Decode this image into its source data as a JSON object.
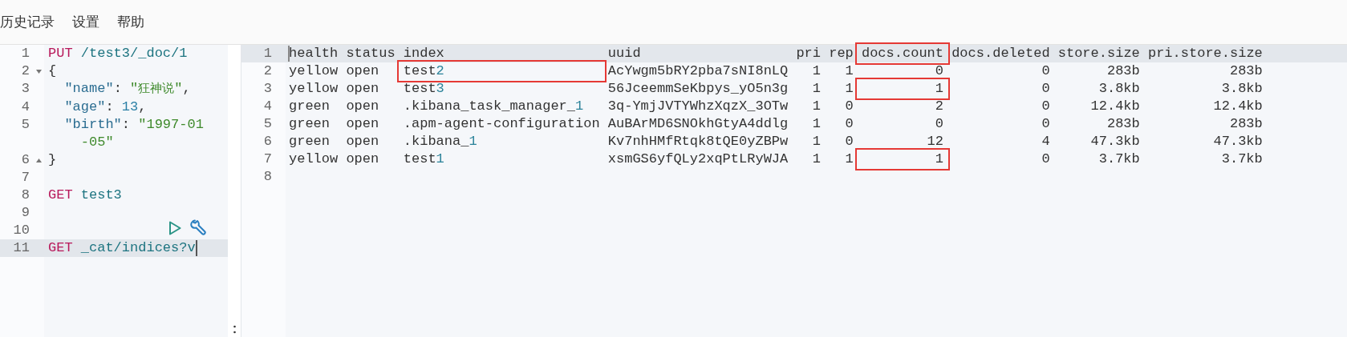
{
  "menu": [
    {
      "label": "历史记录"
    },
    {
      "label": "设置"
    },
    {
      "label": "帮助"
    }
  ],
  "editor": {
    "lines": [
      {
        "number": "1",
        "fold_start": false,
        "fold_end": false,
        "active": false,
        "actions": false,
        "tokens": [
          {
            "kind": "method",
            "text": "PUT"
          },
          {
            "kind": "path",
            "text": " /test3/_doc/1"
          }
        ]
      },
      {
        "number": "2",
        "fold_start": true,
        "fold_end": false,
        "active": false,
        "actions": false,
        "tokens": [
          {
            "kind": "punct",
            "text": "{"
          }
        ]
      },
      {
        "number": "3",
        "fold_start": false,
        "fold_end": false,
        "active": false,
        "actions": false,
        "tokens": [
          {
            "kind": "key",
            "text": "  \"name\""
          },
          {
            "kind": "punct",
            "text": ": "
          },
          {
            "kind": "string",
            "text": "\"狂神说\""
          },
          {
            "kind": "punct",
            "text": ","
          }
        ]
      },
      {
        "number": "4",
        "fold_start": false,
        "fold_end": false,
        "active": false,
        "actions": false,
        "tokens": [
          {
            "kind": "key",
            "text": "  \"age\""
          },
          {
            "kind": "punct",
            "text": ": "
          },
          {
            "kind": "number",
            "text": "13"
          },
          {
            "kind": "punct",
            "text": ","
          }
        ]
      },
      {
        "number": "5",
        "fold_start": false,
        "fold_end": false,
        "active": false,
        "actions": false,
        "tokens": [
          {
            "kind": "key",
            "text": "  \"birth\""
          },
          {
            "kind": "punct",
            "text": ": "
          },
          {
            "kind": "string",
            "text": "\"1997-01-05\""
          }
        ]
      },
      {
        "number": "6",
        "fold_start": false,
        "fold_end": true,
        "active": false,
        "actions": false,
        "tokens": [
          {
            "kind": "punct",
            "text": "}"
          }
        ]
      },
      {
        "number": "7",
        "fold_start": false,
        "fold_end": false,
        "active": false,
        "actions": false
      },
      {
        "number": "8",
        "fold_start": false,
        "fold_end": false,
        "active": false,
        "actions": false,
        "tokens": [
          {
            "kind": "method",
            "text": "GET"
          },
          {
            "kind": "path",
            "text": " test3"
          }
        ]
      },
      {
        "number": "9",
        "fold_start": false,
        "fold_end": false,
        "active": false,
        "actions": false
      },
      {
        "number": "10",
        "fold_start": false,
        "fold_end": false,
        "active": false,
        "actions": true
      },
      {
        "number": "11",
        "fold_start": false,
        "fold_end": false,
        "active": true,
        "actions": false,
        "tokens": [
          {
            "kind": "method",
            "text": "GET"
          },
          {
            "kind": "path",
            "text": " _cat/indices?v"
          }
        ]
      }
    ]
  },
  "output": {
    "columns": [
      {
        "right_aligned": false
      },
      {
        "right_aligned": false
      },
      {
        "right_aligned": false
      },
      {
        "right_aligned": false
      },
      {
        "right_aligned": true
      },
      {
        "right_aligned": true
      },
      {
        "right_aligned": true
      },
      {
        "right_aligned": true
      },
      {
        "right_aligned": true
      },
      {
        "right_aligned": true
      }
    ],
    "lines": [
      {
        "number": "1",
        "active": true,
        "kind": "header",
        "cells": [
          {
            "text": "health",
            "highlighted": false
          },
          {
            "text": "status",
            "highlighted": false
          },
          {
            "text": "index",
            "highlighted": false
          },
          {
            "text": "uuid",
            "highlighted": false
          },
          {
            "text": "pri",
            "highlighted": false
          },
          {
            "text": "rep",
            "highlighted": false
          },
          {
            "text": "docs.count",
            "highlighted": true
          },
          {
            "text": "docs.deleted",
            "highlighted": false
          },
          {
            "text": "store.size",
            "highlighted": false
          },
          {
            "text": "pri.store.size",
            "highlighted": false
          }
        ]
      },
      {
        "number": "2",
        "active": false,
        "kind": "row",
        "cells": [
          {
            "text": "yellow",
            "highlighted": false
          },
          {
            "text": "open",
            "highlighted": false
          },
          {
            "text": "test2",
            "highlighted": true
          },
          {
            "text": "AcYwgm5bRY2pba7sNI8nLQ",
            "highlighted": false
          },
          {
            "text": "1",
            "highlighted": false
          },
          {
            "text": "1",
            "highlighted": false
          },
          {
            "text": "0",
            "highlighted": false
          },
          {
            "text": "0",
            "highlighted": false
          },
          {
            "text": "283b",
            "highlighted": false
          },
          {
            "text": "283b",
            "highlighted": false
          }
        ]
      },
      {
        "number": "3",
        "active": false,
        "kind": "row",
        "cells": [
          {
            "text": "yellow",
            "highlighted": false
          },
          {
            "text": "open",
            "highlighted": false
          },
          {
            "text": "test3",
            "highlighted": false
          },
          {
            "text": "56JceemmSeKbpys_yO5n3g",
            "highlighted": false
          },
          {
            "text": "1",
            "highlighted": false
          },
          {
            "text": "1",
            "highlighted": false
          },
          {
            "text": "1",
            "highlighted": true
          },
          {
            "text": "0",
            "highlighted": false
          },
          {
            "text": "3.8kb",
            "highlighted": false
          },
          {
            "text": "3.8kb",
            "highlighted": false
          }
        ]
      },
      {
        "number": "4",
        "active": false,
        "kind": "row",
        "cells": [
          {
            "text": "green",
            "highlighted": false
          },
          {
            "text": "open",
            "highlighted": false
          },
          {
            "text": ".kibana_task_manager_1",
            "highlighted": false
          },
          {
            "text": "3q-YmjJVTYWhzXqzX_3OTw",
            "highlighted": false
          },
          {
            "text": "1",
            "highlighted": false
          },
          {
            "text": "0",
            "highlighted": false
          },
          {
            "text": "2",
            "highlighted": false
          },
          {
            "text": "0",
            "highlighted": false
          },
          {
            "text": "12.4kb",
            "highlighted": false
          },
          {
            "text": "12.4kb",
            "highlighted": false
          }
        ]
      },
      {
        "number": "5",
        "active": false,
        "kind": "row",
        "cells": [
          {
            "text": "green",
            "highlighted": false
          },
          {
            "text": "open",
            "highlighted": false
          },
          {
            "text": ".apm-agent-configuration",
            "highlighted": false
          },
          {
            "text": "AuBArMD6SNOkhGtyA4ddlg",
            "highlighted": false
          },
          {
            "text": "1",
            "highlighted": false
          },
          {
            "text": "0",
            "highlighted": false
          },
          {
            "text": "0",
            "highlighted": false
          },
          {
            "text": "0",
            "highlighted": false
          },
          {
            "text": "283b",
            "highlighted": false
          },
          {
            "text": "283b",
            "highlighted": false
          }
        ]
      },
      {
        "number": "6",
        "active": false,
        "kind": "row",
        "cells": [
          {
            "text": "green",
            "highlighted": false
          },
          {
            "text": "open",
            "highlighted": false
          },
          {
            "text": ".kibana_1",
            "highlighted": false
          },
          {
            "text": "Kv7nhHMfRtqk8tQE0yZBPw",
            "highlighted": false
          },
          {
            "text": "1",
            "highlighted": false
          },
          {
            "text": "0",
            "highlighted": false
          },
          {
            "text": "12",
            "highlighted": false
          },
          {
            "text": "4",
            "highlighted": false
          },
          {
            "text": "47.3kb",
            "highlighted": false
          },
          {
            "text": "47.3kb",
            "highlighted": false
          }
        ]
      },
      {
        "number": "7",
        "active": false,
        "kind": "row",
        "cells": [
          {
            "text": "yellow",
            "highlighted": false
          },
          {
            "text": "open",
            "highlighted": false
          },
          {
            "text": "test1",
            "highlighted": false
          },
          {
            "text": "xsmGS6yfQLy2xqPtLRyWJA",
            "highlighted": false
          },
          {
            "text": "1",
            "highlighted": false
          },
          {
            "text": "1",
            "highlighted": false
          },
          {
            "text": "1",
            "highlighted": true
          },
          {
            "text": "0",
            "highlighted": false
          },
          {
            "text": "3.7kb",
            "highlighted": false
          },
          {
            "text": "3.7kb",
            "highlighted": false
          }
        ]
      },
      {
        "number": "8",
        "active": false,
        "kind": "blank"
      }
    ]
  }
}
